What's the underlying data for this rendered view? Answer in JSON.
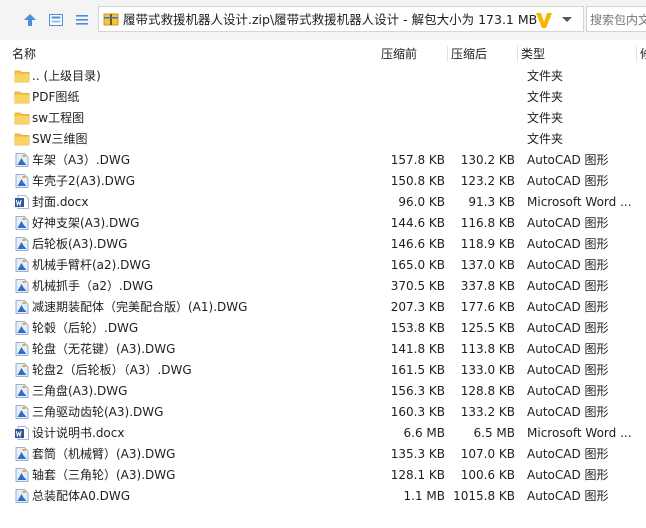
{
  "toolbar": {
    "address_path": "履带式救援机器人设计.zip\\履带式救援机器人设计 - 解包大小为 173.1 MB",
    "search_placeholder": "搜索包内文件"
  },
  "columns": {
    "name": "名称",
    "before": "压缩前",
    "after": "压缩后",
    "type": "类型",
    "modified": "修"
  },
  "files": [
    {
      "name": ".. (上级目录)",
      "before": "",
      "after": "",
      "type": "文件夹",
      "icon": "folder-icon"
    },
    {
      "name": "PDF图纸",
      "before": "",
      "after": "",
      "type": "文件夹",
      "icon": "folder-icon"
    },
    {
      "name": "sw工程图",
      "before": "",
      "after": "",
      "type": "文件夹",
      "icon": "folder-icon"
    },
    {
      "name": "SW三维图",
      "before": "",
      "after": "",
      "type": "文件夹",
      "icon": "folder-icon"
    },
    {
      "name": "车架（A3）.DWG",
      "before": "157.8 KB",
      "after": "130.2 KB",
      "type": "AutoCAD 图形",
      "icon": "dwg-icon"
    },
    {
      "name": "车壳子2(A3).DWG",
      "before": "150.8 KB",
      "after": "123.2 KB",
      "type": "AutoCAD 图形",
      "icon": "dwg-icon"
    },
    {
      "name": "封面.docx",
      "before": "96.0 KB",
      "after": "91.3 KB",
      "type": "Microsoft Word ...",
      "icon": "word-icon"
    },
    {
      "name": "好神支架(A3).DWG",
      "before": "144.6 KB",
      "after": "116.8 KB",
      "type": "AutoCAD 图形",
      "icon": "dwg-icon"
    },
    {
      "name": "后轮板(A3).DWG",
      "before": "146.6 KB",
      "after": "118.9 KB",
      "type": "AutoCAD 图形",
      "icon": "dwg-icon"
    },
    {
      "name": "机械手臂杆(a2).DWG",
      "before": "165.0 KB",
      "after": "137.0 KB",
      "type": "AutoCAD 图形",
      "icon": "dwg-icon"
    },
    {
      "name": "机械抓手（a2）.DWG",
      "before": "370.5 KB",
      "after": "337.8 KB",
      "type": "AutoCAD 图形",
      "icon": "dwg-icon"
    },
    {
      "name": "减速期装配体（完美配合版）(A1).DWG",
      "before": "207.3 KB",
      "after": "177.6 KB",
      "type": "AutoCAD 图形",
      "icon": "dwg-icon"
    },
    {
      "name": "轮毂（后轮）.DWG",
      "before": "153.8 KB",
      "after": "125.5 KB",
      "type": "AutoCAD 图形",
      "icon": "dwg-icon"
    },
    {
      "name": "轮盘（无花键）(A3).DWG",
      "before": "141.8 KB",
      "after": "113.8 KB",
      "type": "AutoCAD 图形",
      "icon": "dwg-icon"
    },
    {
      "name": "轮盘2（后轮板）（A3）.DWG",
      "before": "161.5 KB",
      "after": "133.0 KB",
      "type": "AutoCAD 图形",
      "icon": "dwg-icon"
    },
    {
      "name": "三角盘(A3).DWG",
      "before": "156.3 KB",
      "after": "128.8 KB",
      "type": "AutoCAD 图形",
      "icon": "dwg-icon"
    },
    {
      "name": "三角驱动齿轮(A3).DWG",
      "before": "160.3 KB",
      "after": "133.2 KB",
      "type": "AutoCAD 图形",
      "icon": "dwg-icon"
    },
    {
      "name": "设计说明书.docx",
      "before": "6.6 MB",
      "after": "6.5 MB",
      "type": "Microsoft Word ...",
      "icon": "word-icon"
    },
    {
      "name": "套筒（机械臂）(A3).DWG",
      "before": "135.3 KB",
      "after": "107.0 KB",
      "type": "AutoCAD 图形",
      "icon": "dwg-icon"
    },
    {
      "name": "轴套（三角轮）(A3).DWG",
      "before": "128.1 KB",
      "after": "100.6 KB",
      "type": "AutoCAD 图形",
      "icon": "dwg-icon"
    },
    {
      "name": "总装配体A0.DWG",
      "before": "1.1 MB",
      "after": "1015.8 KB",
      "type": "AutoCAD 图形",
      "icon": "dwg-icon"
    }
  ],
  "colors": {
    "folder": "#f5c242",
    "dwg_fill": "#e8eef7",
    "dwg_accent": "#2f6fc9",
    "word": "#2b579a",
    "logo": "#f5b800"
  }
}
